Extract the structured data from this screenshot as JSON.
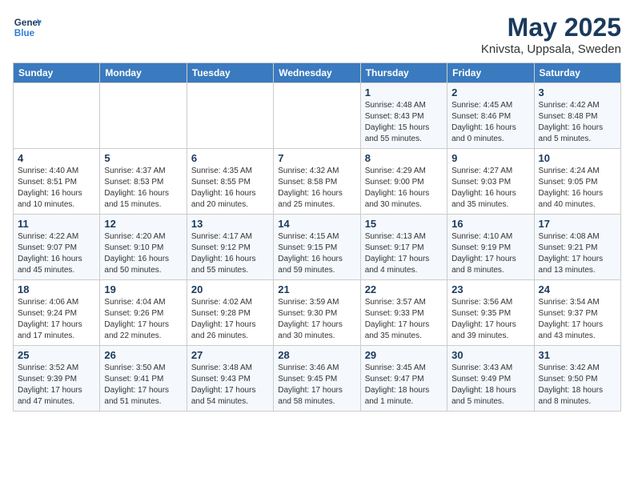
{
  "header": {
    "logo_general": "General",
    "logo_blue": "Blue",
    "month": "May 2025",
    "location": "Knivsta, Uppsala, Sweden"
  },
  "days_of_week": [
    "Sunday",
    "Monday",
    "Tuesday",
    "Wednesday",
    "Thursday",
    "Friday",
    "Saturday"
  ],
  "weeks": [
    [
      {
        "day": "",
        "info": ""
      },
      {
        "day": "",
        "info": ""
      },
      {
        "day": "",
        "info": ""
      },
      {
        "day": "",
        "info": ""
      },
      {
        "day": "1",
        "info": "Sunrise: 4:48 AM\nSunset: 8:43 PM\nDaylight: 15 hours\nand 55 minutes."
      },
      {
        "day": "2",
        "info": "Sunrise: 4:45 AM\nSunset: 8:46 PM\nDaylight: 16 hours\nand 0 minutes."
      },
      {
        "day": "3",
        "info": "Sunrise: 4:42 AM\nSunset: 8:48 PM\nDaylight: 16 hours\nand 5 minutes."
      }
    ],
    [
      {
        "day": "4",
        "info": "Sunrise: 4:40 AM\nSunset: 8:51 PM\nDaylight: 16 hours\nand 10 minutes."
      },
      {
        "day": "5",
        "info": "Sunrise: 4:37 AM\nSunset: 8:53 PM\nDaylight: 16 hours\nand 15 minutes."
      },
      {
        "day": "6",
        "info": "Sunrise: 4:35 AM\nSunset: 8:55 PM\nDaylight: 16 hours\nand 20 minutes."
      },
      {
        "day": "7",
        "info": "Sunrise: 4:32 AM\nSunset: 8:58 PM\nDaylight: 16 hours\nand 25 minutes."
      },
      {
        "day": "8",
        "info": "Sunrise: 4:29 AM\nSunset: 9:00 PM\nDaylight: 16 hours\nand 30 minutes."
      },
      {
        "day": "9",
        "info": "Sunrise: 4:27 AM\nSunset: 9:03 PM\nDaylight: 16 hours\nand 35 minutes."
      },
      {
        "day": "10",
        "info": "Sunrise: 4:24 AM\nSunset: 9:05 PM\nDaylight: 16 hours\nand 40 minutes."
      }
    ],
    [
      {
        "day": "11",
        "info": "Sunrise: 4:22 AM\nSunset: 9:07 PM\nDaylight: 16 hours\nand 45 minutes."
      },
      {
        "day": "12",
        "info": "Sunrise: 4:20 AM\nSunset: 9:10 PM\nDaylight: 16 hours\nand 50 minutes."
      },
      {
        "day": "13",
        "info": "Sunrise: 4:17 AM\nSunset: 9:12 PM\nDaylight: 16 hours\nand 55 minutes."
      },
      {
        "day": "14",
        "info": "Sunrise: 4:15 AM\nSunset: 9:15 PM\nDaylight: 16 hours\nand 59 minutes."
      },
      {
        "day": "15",
        "info": "Sunrise: 4:13 AM\nSunset: 9:17 PM\nDaylight: 17 hours\nand 4 minutes."
      },
      {
        "day": "16",
        "info": "Sunrise: 4:10 AM\nSunset: 9:19 PM\nDaylight: 17 hours\nand 8 minutes."
      },
      {
        "day": "17",
        "info": "Sunrise: 4:08 AM\nSunset: 9:21 PM\nDaylight: 17 hours\nand 13 minutes."
      }
    ],
    [
      {
        "day": "18",
        "info": "Sunrise: 4:06 AM\nSunset: 9:24 PM\nDaylight: 17 hours\nand 17 minutes."
      },
      {
        "day": "19",
        "info": "Sunrise: 4:04 AM\nSunset: 9:26 PM\nDaylight: 17 hours\nand 22 minutes."
      },
      {
        "day": "20",
        "info": "Sunrise: 4:02 AM\nSunset: 9:28 PM\nDaylight: 17 hours\nand 26 minutes."
      },
      {
        "day": "21",
        "info": "Sunrise: 3:59 AM\nSunset: 9:30 PM\nDaylight: 17 hours\nand 30 minutes."
      },
      {
        "day": "22",
        "info": "Sunrise: 3:57 AM\nSunset: 9:33 PM\nDaylight: 17 hours\nand 35 minutes."
      },
      {
        "day": "23",
        "info": "Sunrise: 3:56 AM\nSunset: 9:35 PM\nDaylight: 17 hours\nand 39 minutes."
      },
      {
        "day": "24",
        "info": "Sunrise: 3:54 AM\nSunset: 9:37 PM\nDaylight: 17 hours\nand 43 minutes."
      }
    ],
    [
      {
        "day": "25",
        "info": "Sunrise: 3:52 AM\nSunset: 9:39 PM\nDaylight: 17 hours\nand 47 minutes."
      },
      {
        "day": "26",
        "info": "Sunrise: 3:50 AM\nSunset: 9:41 PM\nDaylight: 17 hours\nand 51 minutes."
      },
      {
        "day": "27",
        "info": "Sunrise: 3:48 AM\nSunset: 9:43 PM\nDaylight: 17 hours\nand 54 minutes."
      },
      {
        "day": "28",
        "info": "Sunrise: 3:46 AM\nSunset: 9:45 PM\nDaylight: 17 hours\nand 58 minutes."
      },
      {
        "day": "29",
        "info": "Sunrise: 3:45 AM\nSunset: 9:47 PM\nDaylight: 18 hours\nand 1 minute."
      },
      {
        "day": "30",
        "info": "Sunrise: 3:43 AM\nSunset: 9:49 PM\nDaylight: 18 hours\nand 5 minutes."
      },
      {
        "day": "31",
        "info": "Sunrise: 3:42 AM\nSunset: 9:50 PM\nDaylight: 18 hours\nand 8 minutes."
      }
    ]
  ]
}
